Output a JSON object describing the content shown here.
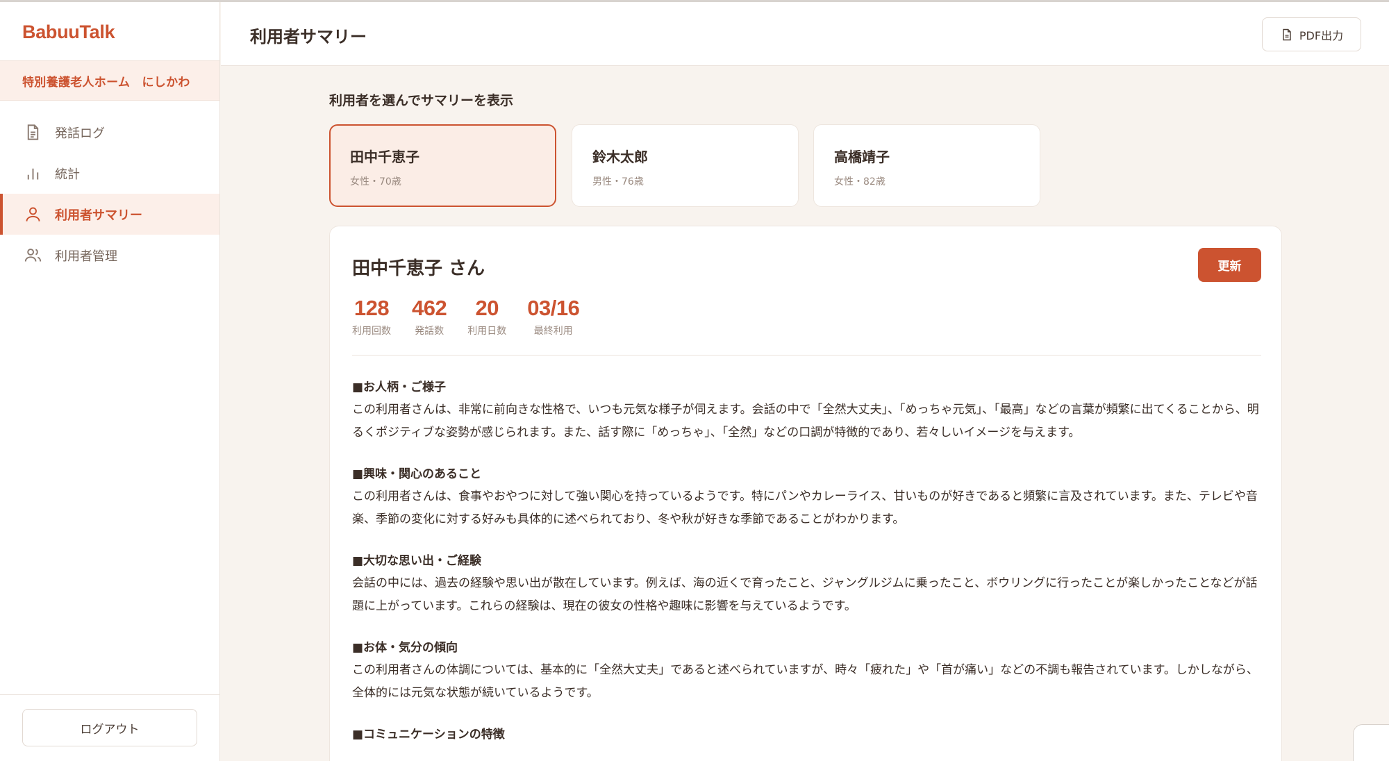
{
  "app": {
    "brand": "BabuuTalk",
    "facility": "特別養護老人ホーム　にしかわ"
  },
  "nav": {
    "items": [
      {
        "label": "発話ログ",
        "icon": "document-icon"
      },
      {
        "label": "統計",
        "icon": "bar-chart-icon"
      },
      {
        "label": "利用者サマリー",
        "icon": "user-icon",
        "active": true
      },
      {
        "label": "利用者管理",
        "icon": "users-icon"
      }
    ],
    "logout_label": "ログアウト"
  },
  "header": {
    "title": "利用者サマリー",
    "pdf_label": "PDF出力"
  },
  "select": {
    "label": "利用者を選んでサマリーを表示",
    "users": [
      {
        "name": "田中千恵子",
        "meta": "女性・70歳"
      },
      {
        "name": "鈴木太郎",
        "meta": "男性・76歳"
      },
      {
        "name": "高橋靖子",
        "meta": "女性・82歳"
      }
    ]
  },
  "summary": {
    "title": "田中千恵子 さん",
    "refresh_label": "更新",
    "stats": [
      {
        "value": "128",
        "label": "利用回数"
      },
      {
        "value": "462",
        "label": "発話数"
      },
      {
        "value": "20",
        "label": "利用日数"
      },
      {
        "value": "03/16",
        "label": "最終利用"
      }
    ],
    "sections": [
      {
        "heading": "■お人柄・ご様子",
        "body": "この利用者さんは、非常に前向きな性格で、いつも元気な様子が伺えます。会話の中で「全然大丈夫」、「めっちゃ元気」、「最高」などの言葉が頻繁に出てくることから、明るくポジティブな姿勢が感じられます。また、話す際に「めっちゃ」、「全然」などの口調が特徴的であり、若々しいイメージを与えます。"
      },
      {
        "heading": "■興味・関心のあること",
        "body": "この利用者さんは、食事やおやつに対して強い関心を持っているようです。特にパンやカレーライス、甘いものが好きであると頻繁に言及されています。また、テレビや音楽、季節の変化に対する好みも具体的に述べられており、冬や秋が好きな季節であることがわかります。"
      },
      {
        "heading": "■大切な思い出・ご経験",
        "body": "会話の中には、過去の経験や思い出が散在しています。例えば、海の近くで育ったこと、ジャングルジムに乗ったこと、ボウリングに行ったことが楽しかったことなどが話題に上がっています。これらの経験は、現在の彼女の性格や趣味に影響を与えているようです。"
      },
      {
        "heading": "■お体・気分の傾向",
        "body": "この利用者さんの体調については、基本的に「全然大丈夫」であると述べられていますが、時々「疲れた」や「首が痛い」などの不調も報告されています。しかしながら、全体的には元気な状態が続いているようです。"
      },
      {
        "heading": "■コミュニケーションの特徴",
        "body": ""
      }
    ]
  },
  "colors": {
    "accent": "#cc5330",
    "accent_soft": "#fcefe9",
    "background": "#f8f3ee"
  }
}
